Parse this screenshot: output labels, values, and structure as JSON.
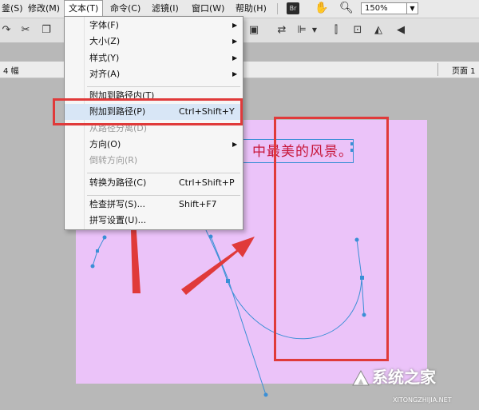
{
  "menubar": {
    "items": [
      "釜(S)",
      "修改(M)",
      "文本(T)",
      "命令(C)",
      "滤镜(I)",
      "窗口(W)",
      "帮助(H)"
    ],
    "br_label": "Br",
    "zoom": "150%"
  },
  "panelbar": {
    "left_label": "4 幅",
    "right_label": "页面 1"
  },
  "text_menu": {
    "items": [
      {
        "label": "字体(F)",
        "shortcut": "",
        "submenu": true,
        "disabled": false
      },
      {
        "label": "大小(Z)",
        "shortcut": "",
        "submenu": true,
        "disabled": false
      },
      {
        "label": "样式(Y)",
        "shortcut": "",
        "submenu": true,
        "disabled": false
      },
      {
        "label": "对齐(A)",
        "shortcut": "",
        "submenu": true,
        "disabled": false
      },
      {
        "label": "附加到路径内(T)",
        "shortcut": "",
        "submenu": false,
        "disabled": false
      },
      {
        "label": "附加到路径(P)",
        "shortcut": "Ctrl+Shift+Y",
        "submenu": false,
        "disabled": false
      },
      {
        "label": "从路径分离(D)",
        "shortcut": "",
        "submenu": false,
        "disabled": true
      },
      {
        "label": "方向(O)",
        "shortcut": "",
        "submenu": true,
        "disabled": false
      },
      {
        "label": "倒转方向(R)",
        "shortcut": "",
        "submenu": false,
        "disabled": true
      },
      {
        "label": "转换为路径(C)",
        "shortcut": "Ctrl+Shift+P",
        "submenu": false,
        "disabled": false
      },
      {
        "label": "检查拼写(S)...",
        "shortcut": "Shift+F7",
        "submenu": false,
        "disabled": false
      },
      {
        "label": "拼写设置(U)...",
        "shortcut": "",
        "submenu": false,
        "disabled": false
      }
    ]
  },
  "canvas": {
    "text": "中最美的风景。",
    "fill_color": "#ebc3f9",
    "text_color": "#c7163a"
  },
  "annotation_color": "#e03a3a",
  "watermark": {
    "logo": "系统之家",
    "url": "XITONGZHIJIA.NET"
  }
}
